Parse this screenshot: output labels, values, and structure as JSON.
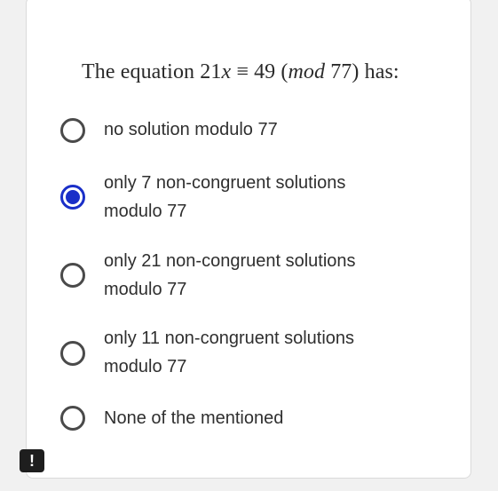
{
  "question": {
    "prefix": "The equation ",
    "math_coef": "21",
    "math_var": "x",
    "math_rel": " ≡ 49 (",
    "math_mod": "mod",
    "math_end": " 77)",
    "suffix": " has:"
  },
  "options": [
    {
      "label": "no solution modulo 77",
      "selected": false
    },
    {
      "label": "only 7 non-congruent solutions modulo 77",
      "selected": true
    },
    {
      "label": "only 21 non-congruent solutions modulo 77",
      "selected": false
    },
    {
      "label": "only 11 non-congruent solutions modulo 77",
      "selected": false
    },
    {
      "label": "None of the mentioned",
      "selected": false
    }
  ],
  "alert_badge": {
    "symbol": "!"
  },
  "colors": {
    "accent": "#1a2fc8",
    "text": "#2f2f2f",
    "background": "#f1f1f1",
    "card": "#ffffff"
  }
}
